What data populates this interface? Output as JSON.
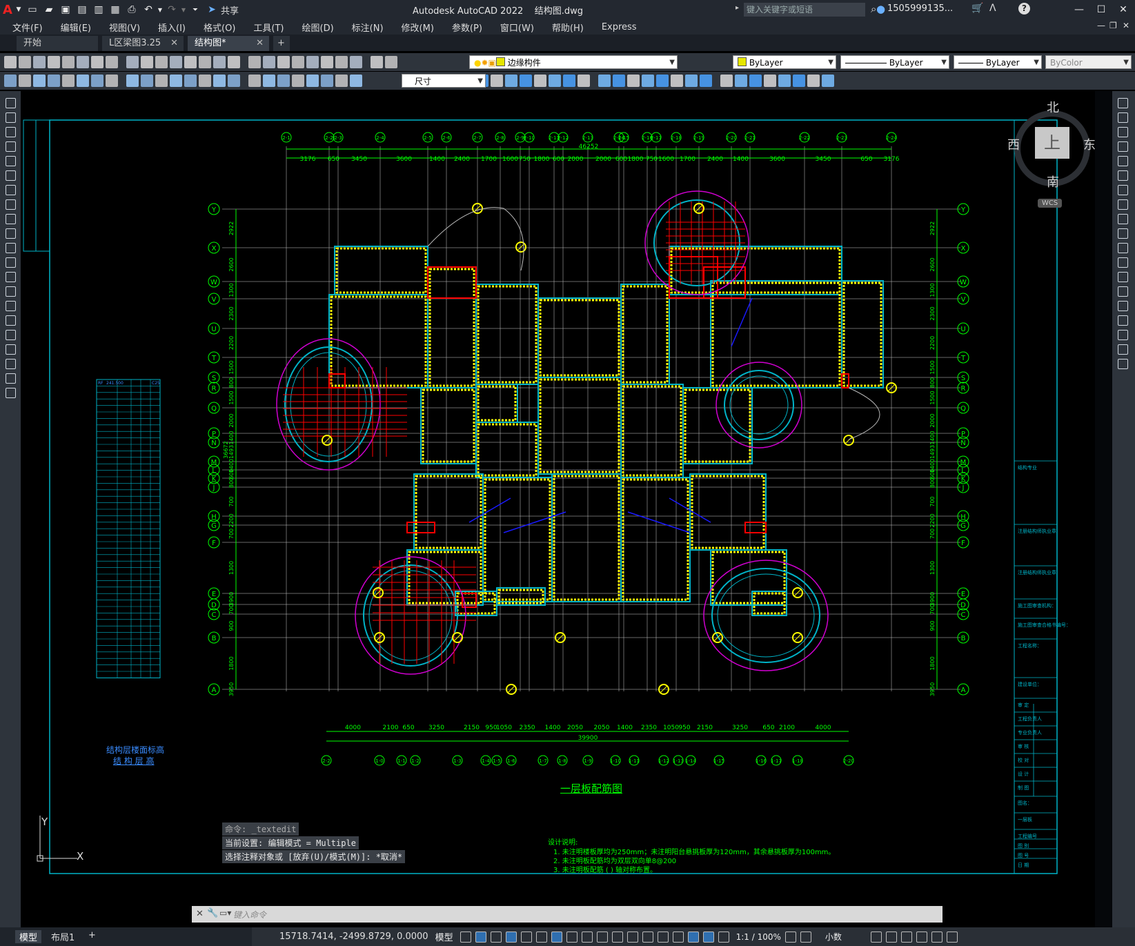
{
  "app": {
    "title": "Autodesk AutoCAD 2022",
    "filename": "结构图.dwg",
    "share_label": "共享",
    "search_placeholder": "键入关键字或短语",
    "user": "1505999135...",
    "logo": "A"
  },
  "menu": [
    "文件(F)",
    "编辑(E)",
    "视图(V)",
    "插入(I)",
    "格式(O)",
    "工具(T)",
    "绘图(D)",
    "标注(N)",
    "修改(M)",
    "参数(P)",
    "窗口(W)",
    "帮助(H)",
    "Express"
  ],
  "tabs": [
    {
      "label": "开始",
      "closable": false
    },
    {
      "label": "L区梁图3.25",
      "closable": true
    },
    {
      "label": "结构图*",
      "closable": true,
      "active": true
    }
  ],
  "toolbar": {
    "layer_name": "边缘构件",
    "color": "ByLayer",
    "linetype": "ByLayer",
    "lineweight": "ByLayer",
    "plotstyle": "ByColor",
    "dimstyle": "尺寸"
  },
  "viewcube": {
    "north": "北",
    "south": "南",
    "east": "东",
    "west": "西",
    "top": "上",
    "wcs": "WCS"
  },
  "drawing": {
    "title": "一层板配筋图",
    "notes_heading": "设计说明:",
    "notes": [
      "1. 未注明楼板厚均为250mm；未注明阳台悬挑板厚为120mm，其余悬挑板厚为100mm。",
      "2. 未注明板配筋均为双层双向单8@200",
      "3. 未注明板配筋 ( ) 轴对称布置。"
    ],
    "total_top": "46252",
    "total_bottom": "39900",
    "side_total": "36672",
    "top_dims": [
      "3176",
      "650",
      "3450",
      "3600",
      "1400",
      "2400",
      "1700",
      "1600",
      "750",
      "1800",
      "600",
      "2000",
      "2000",
      "600",
      "1800",
      "750",
      "1600",
      "1700",
      "2400",
      "1400",
      "3600",
      "3450",
      "650",
      "3176"
    ],
    "bottom_dims": [
      "4000",
      "2100",
      "650",
      "3250",
      "2150",
      "950",
      "1050",
      "2350",
      "1400",
      "2050",
      "2050",
      "1400",
      "2350",
      "1050",
      "950",
      "2150",
      "3250",
      "650",
      "2100",
      "4000"
    ],
    "top_axes": [
      "2-1",
      "2-2",
      "2-3",
      "2-4",
      "2-5",
      "2-6",
      "2-7",
      "2-8",
      "2-9",
      "2-10",
      "2-11",
      "2-12",
      "2-13",
      "2-14",
      "2-15",
      "2-16",
      "2-17",
      "2-18",
      "2-19",
      "2-20",
      "2-21",
      "2-22",
      "2-23",
      "2-24"
    ],
    "bottom_axes": [
      "2-2",
      "1-0",
      "1-1",
      "1-2",
      "1-3",
      "1-4",
      "1-5",
      "1-6",
      "1-7",
      "1-8",
      "1-9",
      "1-10",
      "1-11",
      "1-12",
      "1-13",
      "1-14",
      "1-15",
      "1-16",
      "1-17",
      "1-18",
      "2-20"
    ],
    "row_axes": [
      "Y",
      "X",
      "W",
      "V",
      "U",
      "T",
      "S",
      "R",
      "Q",
      "P",
      "N",
      "M",
      "L",
      "K",
      "J",
      "H",
      "G",
      "F",
      "E",
      "D",
      "C",
      "B",
      "A"
    ],
    "side_dims": [
      "2922",
      "2600",
      "1300",
      "2300",
      "2200",
      "1500",
      "800",
      "1500",
      "2000",
      "1400",
      "1493",
      "1400",
      "600",
      "800",
      "700",
      "2200",
      "700",
      "1300",
      "3900",
      "700",
      "900",
      "1800",
      "3950"
    ],
    "floor_table_caption1": "结构层楼面标高",
    "floor_table_caption2": "结 构 层 高",
    "floor_table_header": [
      "RF",
      "241.500",
      "",
      "C25"
    ],
    "title_block": [
      "结构专业",
      "注册结构师执业章",
      "注册结构师执业章",
      "施工图审查机构：",
      "施工图审查合格书编号：",
      "工程名称：",
      "建设单位：",
      "审 定",
      "工程负责人",
      "专业负责人",
      "审 核",
      "校 对",
      "设 计",
      "制 图",
      "图名：",
      "一层板",
      "工程编号",
      "图 别",
      "图 号",
      "日 期"
    ],
    "ucs_x": "X",
    "ucs_y": "Y"
  },
  "command": {
    "history": [
      "命令: _textedit",
      "当前设置: 编辑模式 = Multiple",
      "选择注释对象或 [放弃(U)/模式(M)]: *取消*"
    ],
    "placeholder": "键入命令"
  },
  "layout_tabs": [
    "模型",
    "布局1"
  ],
  "status": {
    "coords": "15718.7414, -2499.8729, 0.0000",
    "space": "模型",
    "scale": "1:1 / 100%",
    "units": "小数"
  },
  "colors": {
    "cyan": "#00b4c8",
    "green": "#00ff00",
    "yellow": "#ffff00",
    "magenta": "#d000d0",
    "red": "#ff0000",
    "blue": "#1a1aff",
    "grid": "#cfcfcf"
  }
}
